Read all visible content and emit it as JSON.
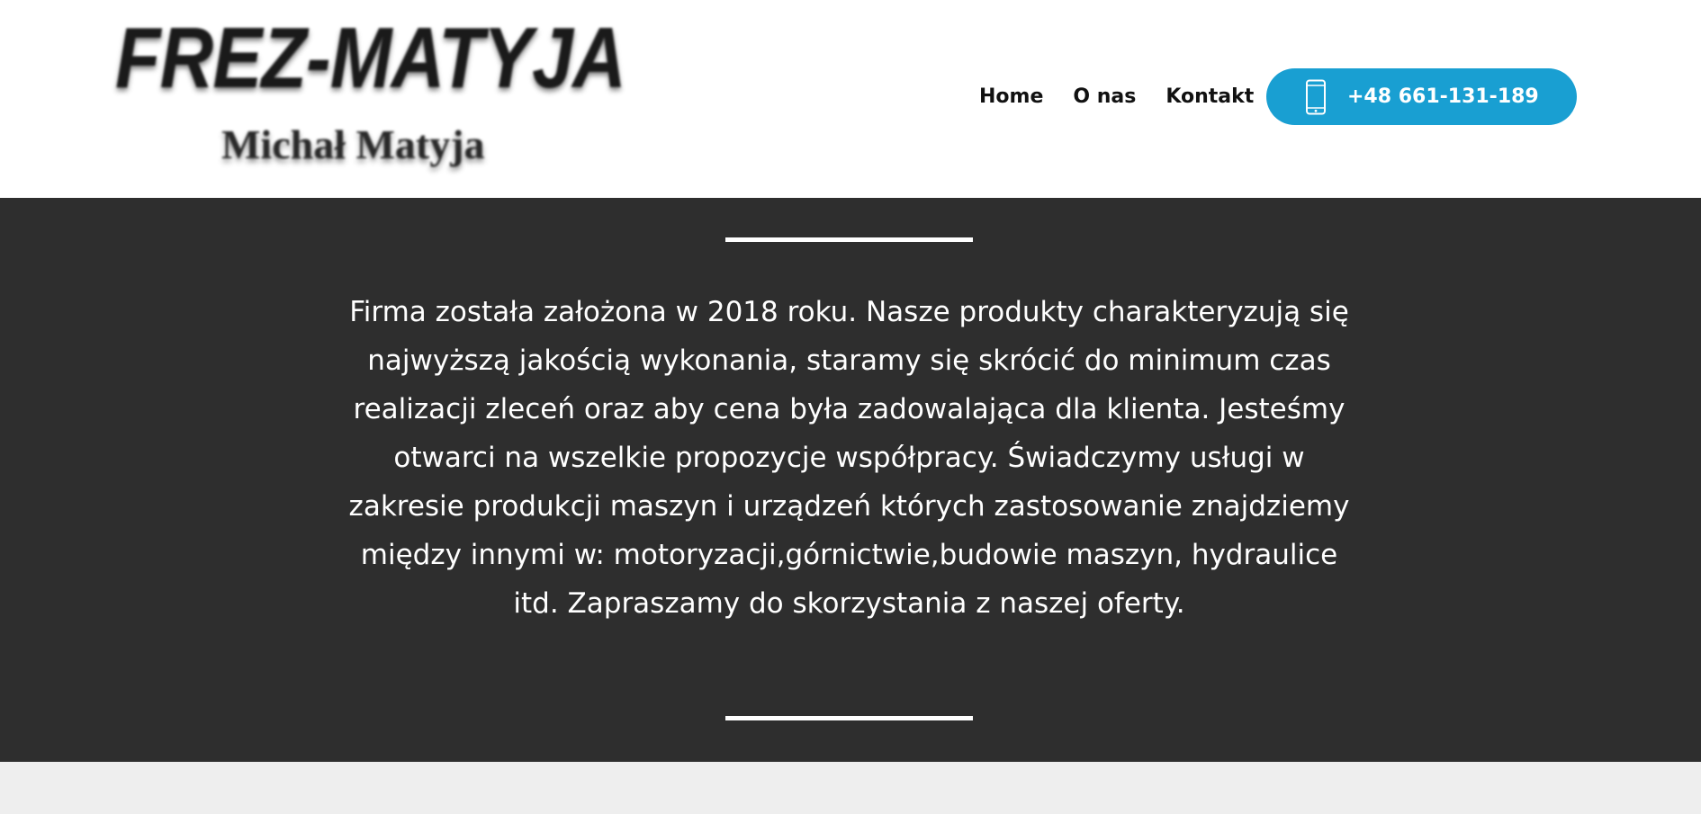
{
  "header": {
    "logo": {
      "title": "FREZ-MATYJA",
      "subtitle": "Michał Matyja"
    },
    "nav": {
      "items": [
        {
          "label": "Home"
        },
        {
          "label": "O nas"
        },
        {
          "label": "Kontakt"
        }
      ]
    },
    "phone": {
      "icon": "smartphone-icon",
      "label": "+48 661-131-189",
      "color": "#199fd2"
    }
  },
  "about": {
    "background": "#2e2e2e",
    "text": "Firma została założona w 2018 roku. Nasze produkty charakteryzują się najwyższą jakością wykonania, staramy się skrócić do minimum czas realizacji zleceń oraz aby cena była zadowalająca dla klienta. Jesteśmy otwarci na wszelkie propozycje współpracy. Świadczymy usługi w zakresie produkcji maszyn i urządzeń których zastosowanie znajdziemy między innymi w: motoryzacji,górnictwie,budowie maszyn, hydraulice itd. Zapraszamy do skorzystania z naszej oferty."
  }
}
